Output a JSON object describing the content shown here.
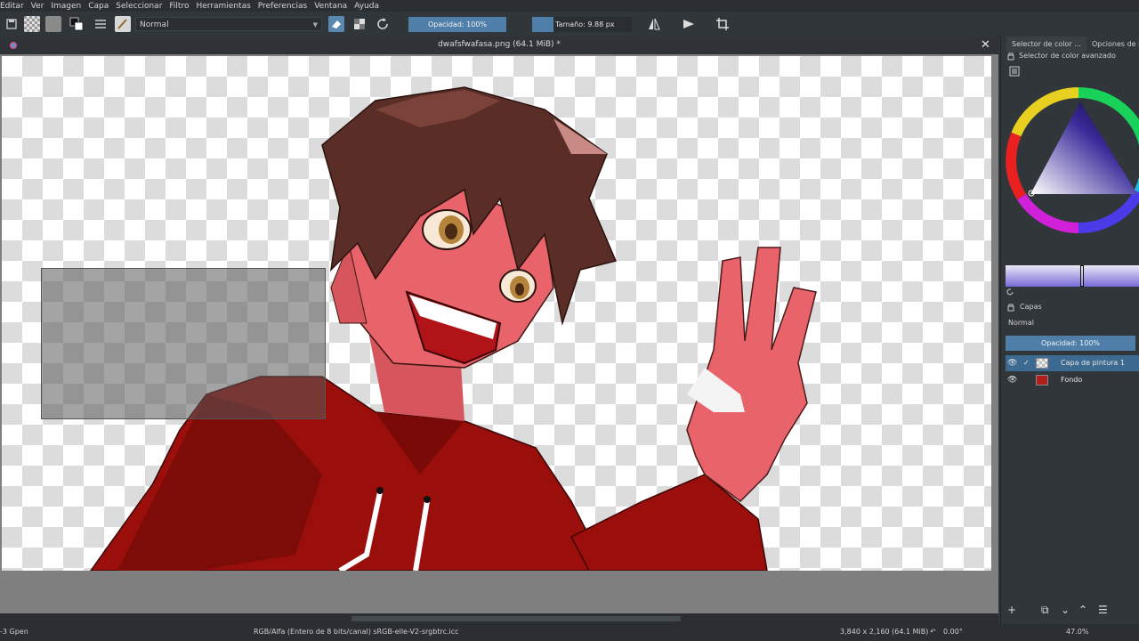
{
  "menu": [
    "Editar",
    "Ver",
    "Imagen",
    "Capa",
    "Seleccionar",
    "Filtro",
    "Herramientas",
    "Preferencias",
    "Ventana",
    "Ayuda"
  ],
  "toolbar": {
    "blend_mode": "Normal",
    "opacity_label": "Opacidad: 100%",
    "size_label": "Tamaño: 9.88 px"
  },
  "document": {
    "title": "dwafsfwafasa.png (64.1 MiB) *",
    "close_glyph": "✕"
  },
  "dock": {
    "tab_color_selector": "Selector de color ...",
    "tab_options": "Opciones de la h",
    "color_panel_title": "Selector de color avanzado",
    "layers_title": "Capas",
    "layers_blend": "Normal",
    "layers_opacity": "Opacidad:  100%",
    "layers": [
      {
        "name": "Capa de pintura 1",
        "active": true
      },
      {
        "name": "Fondo",
        "active": false
      }
    ]
  },
  "status": {
    "left": "-3 Gpen",
    "color_space": "RGB/Alfa (Entero de 8 bits/canal)  sRGB-elle-V2-srgbtrc.icc",
    "dimensions": "3,840 x 2,160 (64.1 MiB)",
    "rotation": "0.00°",
    "zoom": "47.0%"
  },
  "colors": {
    "accent": "#4f7fa8",
    "hoodie": "#9a0f0b",
    "skin": "#e8646a",
    "hair": "#5a2e26"
  }
}
